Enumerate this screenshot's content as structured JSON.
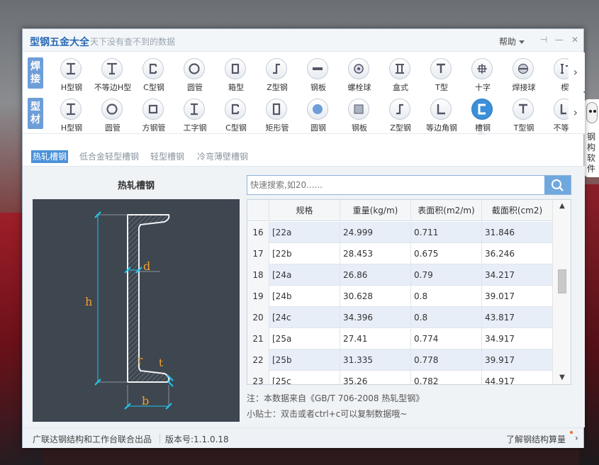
{
  "app": {
    "title": "型钢五金大全",
    "slogan": "天下没有查不到的数据",
    "help": "帮助"
  },
  "mascot_text": [
    "钢",
    "构",
    "软",
    "件"
  ],
  "categories": [
    {
      "label": "焊接",
      "items": [
        {
          "label": "H型钢",
          "icon": "h-beam-icon"
        },
        {
          "label": "不等边H型",
          "icon": "unequal-h-icon"
        },
        {
          "label": "C型钢",
          "icon": "c-steel-icon"
        },
        {
          "label": "圆管",
          "icon": "round-pipe-icon"
        },
        {
          "label": "箱型",
          "icon": "box-section-icon"
        },
        {
          "label": "Z型钢",
          "icon": "z-steel-icon"
        },
        {
          "label": "钢板",
          "icon": "steel-plate-icon"
        },
        {
          "label": "螺栓球",
          "icon": "bolt-ball-icon"
        },
        {
          "label": "盒式",
          "icon": "box-type-icon"
        },
        {
          "label": "T型",
          "icon": "t-section-icon"
        },
        {
          "label": "十字",
          "icon": "cross-section-icon"
        },
        {
          "label": "焊接球",
          "icon": "welded-ball-icon"
        },
        {
          "label": "楔",
          "icon": "wedge-icon"
        }
      ]
    },
    {
      "label": "型材",
      "items": [
        {
          "label": "H型钢",
          "icon": "h-beam-icon"
        },
        {
          "label": "圆管",
          "icon": "round-pipe-icon"
        },
        {
          "label": "方钢管",
          "icon": "square-tube-icon"
        },
        {
          "label": "工字钢",
          "icon": "i-beam-icon"
        },
        {
          "label": "C型钢",
          "icon": "c-steel-icon"
        },
        {
          "label": "矩形管",
          "icon": "rect-tube-icon"
        },
        {
          "label": "圆钢",
          "icon": "round-bar-icon"
        },
        {
          "label": "钢板",
          "icon": "steel-plate-icon"
        },
        {
          "label": "Z型钢",
          "icon": "z-steel-icon"
        },
        {
          "label": "等边角钢",
          "icon": "equal-angle-icon"
        },
        {
          "label": "槽钢",
          "icon": "channel-steel-icon"
        },
        {
          "label": "T型钢",
          "icon": "t-steel-icon"
        },
        {
          "label": "不等边",
          "icon": "unequal-angle-icon"
        }
      ]
    }
  ],
  "subtabs": [
    "热轧槽钢",
    "低合金轻型槽钢",
    "轻型槽钢",
    "冷弯薄壁槽钢"
  ],
  "diagram": {
    "title": "热轧槽钢",
    "labels": {
      "h": "h",
      "d": "d",
      "b": "b",
      "r": "r",
      "t": "t"
    }
  },
  "search": {
    "placeholder": "快速搜索,如20......",
    "icon": "search-icon"
  },
  "table": {
    "headers": [
      "规格",
      "重量(kg/m)",
      "表面积(m2/m)",
      "截面积(cm2)"
    ],
    "rows": [
      {
        "idx": "16",
        "spec": "[22a",
        "weight": "24.999",
        "surface": "0.711",
        "section": "31.846"
      },
      {
        "idx": "17",
        "spec": "[22b",
        "weight": "28.453",
        "surface": "0.675",
        "section": "36.246"
      },
      {
        "idx": "18",
        "spec": "[24a",
        "weight": "26.86",
        "surface": "0.79",
        "section": "34.217"
      },
      {
        "idx": "19",
        "spec": "[24b",
        "weight": "30.628",
        "surface": "0.8",
        "section": "39.017"
      },
      {
        "idx": "20",
        "spec": "[24c",
        "weight": "34.396",
        "surface": "0.8",
        "section": "43.817"
      },
      {
        "idx": "21",
        "spec": "[25a",
        "weight": "27.41",
        "surface": "0.774",
        "section": "34.917"
      },
      {
        "idx": "22",
        "spec": "[25b",
        "weight": "31.335",
        "surface": "0.778",
        "section": "39.917"
      },
      {
        "idx": "23",
        "spec": "[25c",
        "weight": "35.26",
        "surface": "0.782",
        "section": "44.917"
      }
    ]
  },
  "notes": {
    "source": "注：本数据来自《GB/T  706-2008 热轧型钢》",
    "tip": "小贴士：双击或者ctrl+c可以复制数据哦~"
  },
  "footer": {
    "credit": "广联达钢结构和工作台联合出品",
    "version": "版本号:1.1.0.18",
    "link": "了解钢结构算量"
  },
  "colors": {
    "accent": "#3b8fd8",
    "label_bg": "#6d9ed8",
    "diagram_bg": "#3e4650",
    "dimension_cyan": "#1ec8f0",
    "dimension_orange": "#f0a030"
  }
}
